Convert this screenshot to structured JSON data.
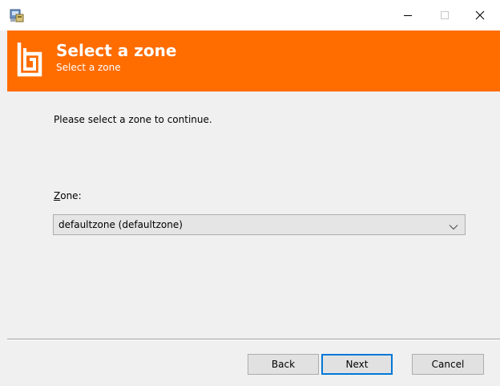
{
  "window": {
    "controls": {
      "minimize_icon": "minimize-icon",
      "maximize_icon": "maximize-icon",
      "close_icon": "close-icon"
    }
  },
  "banner": {
    "title": "Select a zone",
    "subtitle": "Select a zone",
    "background_color": "#ff6c00"
  },
  "content": {
    "instruction": "Please select a zone to continue.",
    "zone_label_accesskey": "Z",
    "zone_label_rest": "one:",
    "zone_selected": "defaultzone (defaultzone)"
  },
  "footer": {
    "back_label": "Back",
    "next_label": "Next",
    "cancel_label": "Cancel"
  }
}
